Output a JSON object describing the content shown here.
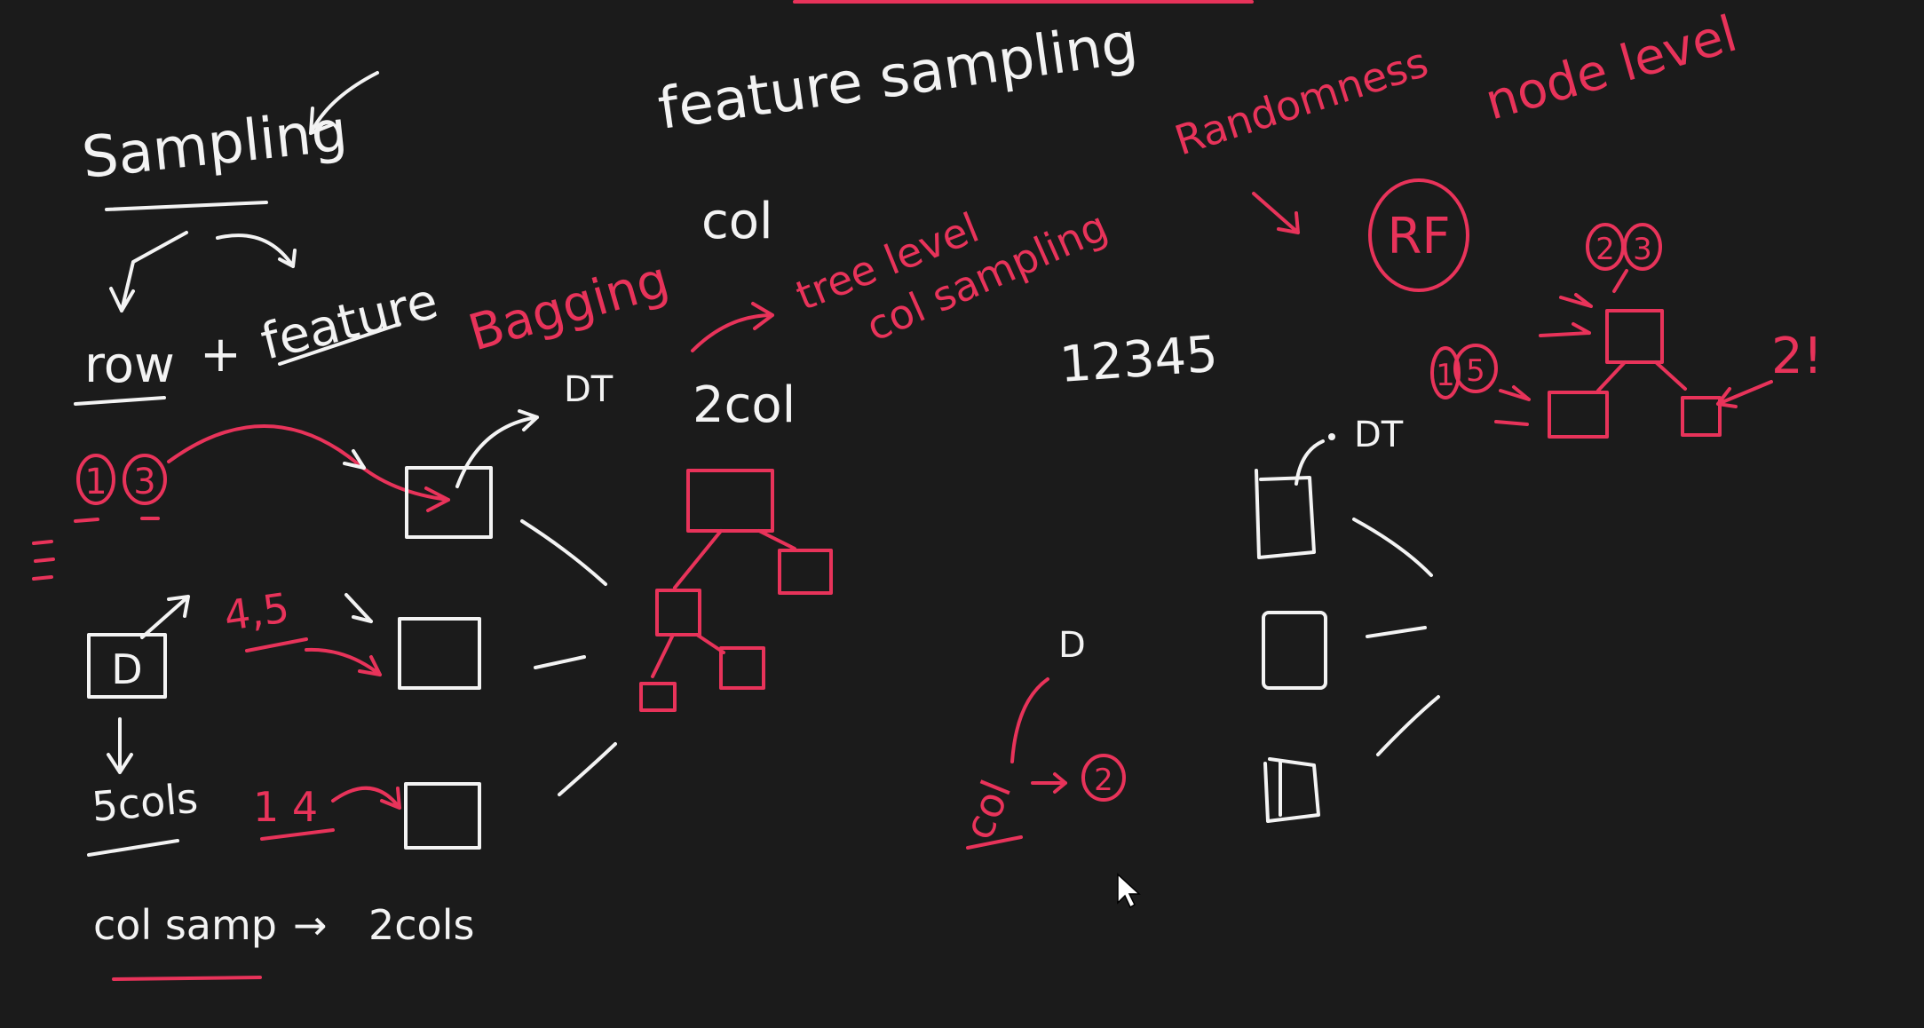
{
  "board": {
    "background_color": "#1b1b1b",
    "ink_white": "#f3f3f3",
    "ink_red": "#e8335a"
  },
  "left": {
    "sampling": "Sampling",
    "row": "row",
    "plus": "+",
    "feature": "feature",
    "bagging": "Bagging",
    "circled_1": "1",
    "circled_3": "3",
    "dt_label": "DT",
    "dataset_label": "D",
    "rows_45": "4,5",
    "rows_14": "1 4",
    "five_cols": "5cols",
    "col_samp": "col samp",
    "arrow": "→",
    "two_cols": "2cols"
  },
  "middle": {
    "feature_sampling": "feature sampling",
    "col": "col",
    "tree_level": "tree level",
    "col_sampling": "col sampling",
    "two_col": "2col",
    "sequence": "12345"
  },
  "right": {
    "randomness": "Randomness",
    "node_level": "node level",
    "rf": "RF",
    "circled_2a": "2",
    "circled_3a": "3",
    "circled_1b": "1",
    "circled_5b": "5",
    "two_bang": "2!",
    "dt_label": "DT",
    "d_label": "D",
    "col_label": "col",
    "circled_2b": "2"
  }
}
